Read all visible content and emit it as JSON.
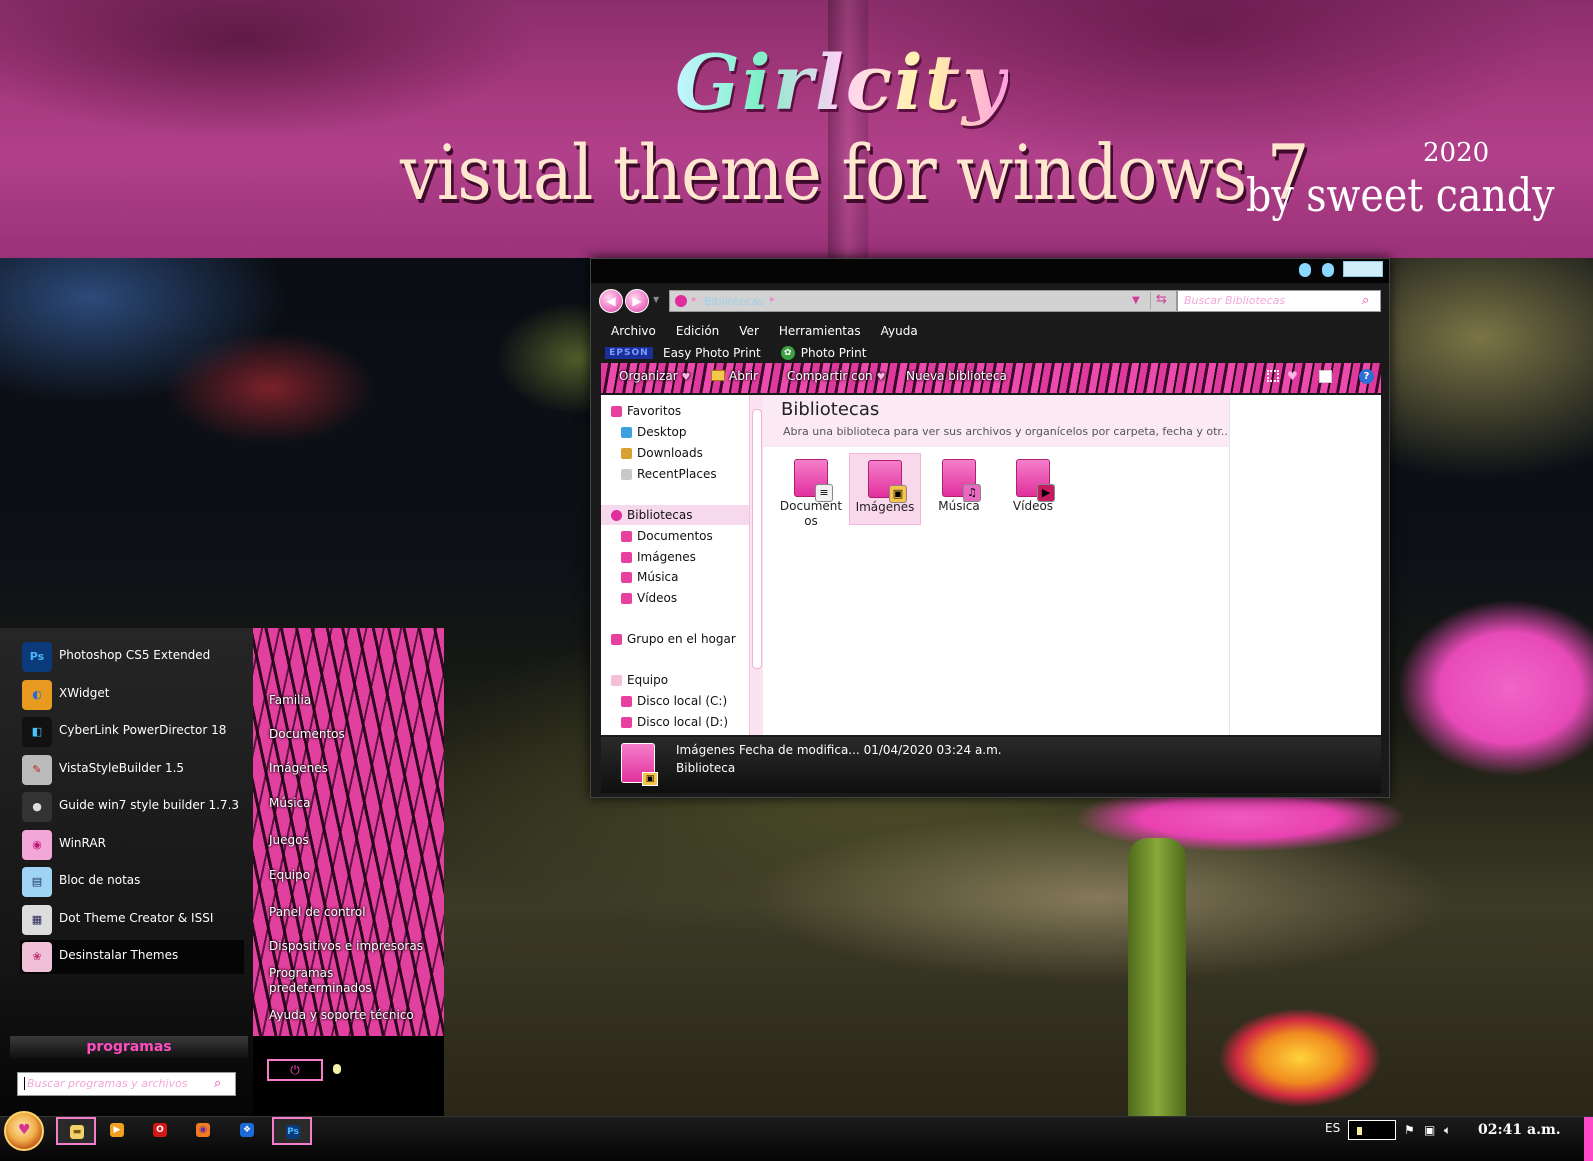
{
  "banner": {
    "theme_name": "Girlcity",
    "tagline": "visual theme  for windows 7",
    "year": "2020",
    "byline": "by sweet candy"
  },
  "explorer": {
    "address_crumb": "Bibliotecas",
    "search_placeholder": "Buscar Bibliotecas",
    "menu": [
      "Archivo",
      "Edición",
      "Ver",
      "Herramientas",
      "Ayuda"
    ],
    "ext_toolbar": {
      "epson_label": "EPSON",
      "easy_photo_print": "Easy Photo Print",
      "photo_print": "Photo Print"
    },
    "command_bar": {
      "organize": "Organizar",
      "open": "Abrir",
      "share": "Compartir con",
      "new_library": "Nueva biblioteca"
    },
    "nav_tree": [
      {
        "label": "Favoritos",
        "level": 0,
        "icon": "star-icon",
        "color": "#e8409e"
      },
      {
        "label": "Desktop",
        "level": 1,
        "icon": "desktop-icon",
        "color": "#3aa0e0"
      },
      {
        "label": "Downloads",
        "level": 1,
        "icon": "downloads-icon",
        "color": "#d8a030"
      },
      {
        "label": "RecentPlaces",
        "level": 1,
        "icon": "recent-places-icon",
        "color": "#c8c8c8"
      },
      {
        "label": "Bibliotecas",
        "level": 0,
        "icon": "library-icon",
        "color": "#e02c9c",
        "selected": true
      },
      {
        "label": "Documentos",
        "level": 1,
        "icon": "documents-icon",
        "color": "#e8409e"
      },
      {
        "label": "Imágenes",
        "level": 1,
        "icon": "images-icon",
        "color": "#e8409e"
      },
      {
        "label": "Música",
        "level": 1,
        "icon": "music-icon",
        "color": "#e8409e"
      },
      {
        "label": "Vídeos",
        "level": 1,
        "icon": "videos-icon",
        "color": "#e8409e"
      },
      {
        "label": "Grupo en el hogar",
        "level": 0,
        "icon": "homegroup-icon",
        "color": "#e8409e"
      },
      {
        "label": "Equipo",
        "level": 0,
        "icon": "computer-icon",
        "color": "#f3c0d8"
      },
      {
        "label": "Disco local (C:)",
        "level": 1,
        "icon": "drive-icon",
        "color": "#e8409e"
      },
      {
        "label": "Disco local (D:)",
        "level": 1,
        "icon": "drive-icon",
        "color": "#e8409e"
      }
    ],
    "content_title": "Bibliotecas",
    "content_desc": "Abra una biblioteca para ver sus archivos y organícelos por carpeta, fecha y otr...",
    "libraries": [
      {
        "label": "Document\nos",
        "badge": "≡",
        "badge_color": "#f0f0f0",
        "icon": "documents-library-icon"
      },
      {
        "label": "Imágenes",
        "badge": "▣",
        "badge_color": "#f5c54a",
        "icon": "images-library-icon",
        "selected": true
      },
      {
        "label": "Música",
        "badge": "♫",
        "badge_color": "#e86ac0",
        "icon": "music-library-icon"
      },
      {
        "label": "Vídeos",
        "badge": "▶",
        "badge_color": "#c81a60",
        "icon": "videos-library-icon"
      }
    ],
    "status": {
      "name": "Imágenes",
      "date": "Fecha de modifica... 01/04/2020 03:24 a.m.",
      "type": "Biblioteca"
    }
  },
  "start_menu": {
    "programs": [
      {
        "label": "Photoshop CS5 Extended",
        "icon": "photoshop-icon",
        "glyph": "Ps",
        "bg": "#0a3a7a",
        "fg": "#4ab4ff"
      },
      {
        "label": "XWidget",
        "icon": "xwidget-icon",
        "glyph": "◐",
        "bg": "#e89a20",
        "fg": "#2a6ad8"
      },
      {
        "label": "CyberLink PowerDirector 18",
        "icon": "powerdirector-icon",
        "glyph": "◧",
        "bg": "#111",
        "fg": "#4ac4ff"
      },
      {
        "label": "VistaStyleBuilder 1.5",
        "icon": "vistastylebuilder-icon",
        "glyph": "✎",
        "bg": "#bbb",
        "fg": "#c02020"
      },
      {
        "label": "Guide win7 style builder 1.7.3",
        "icon": "guide-icon",
        "glyph": "●",
        "bg": "#333",
        "fg": "#ddd"
      },
      {
        "label": "WinRAR",
        "icon": "winrar-icon",
        "glyph": "◉",
        "bg": "#f3a6d8",
        "fg": "#c01a7a"
      },
      {
        "label": "Bloc de notas",
        "icon": "notepad-icon",
        "glyph": "▤",
        "bg": "#9fd4f5",
        "fg": "#236"
      },
      {
        "label": "Dot Theme Creator & ISSI",
        "icon": "dot-theme-creator-icon",
        "glyph": "▦",
        "bg": "#ddd",
        "fg": "#225"
      },
      {
        "label": "Desinstalar Themes",
        "icon": "uninstall-themes-icon",
        "glyph": "❀",
        "bg": "#f0c0d8",
        "fg": "#c03070",
        "selected": true
      }
    ],
    "places": [
      "Familia",
      "Documentos",
      "Imágenes",
      "Música",
      "Juegos",
      "Equipo",
      "Panel de control",
      "Dispositivos e impresoras",
      "Programas\npredeterminados",
      "Ayuda y soporte técnico"
    ],
    "programs_label": "programas",
    "search_placeholder": "Buscar programas y archivos",
    "power_glyph": "⏻"
  },
  "taskbar": {
    "buttons": [
      {
        "icon": "explorer-icon",
        "glyph": "▬",
        "bg": "#f3d068",
        "fg": "#7a5a10",
        "active": true
      },
      {
        "icon": "media-player-icon",
        "glyph": "▶",
        "bg": "#f0a020",
        "fg": "#fff"
      },
      {
        "icon": "opera-icon",
        "glyph": "O",
        "bg": "#d01818",
        "fg": "#fff"
      },
      {
        "icon": "firefox-icon",
        "glyph": "◉",
        "bg": "#f07a20",
        "fg": "#6a2aa8"
      },
      {
        "icon": "dropbox-icon",
        "glyph": "❖",
        "bg": "#1a6ad8",
        "fg": "#fff"
      },
      {
        "icon": "photoshop-taskbar-icon",
        "glyph": "Ps",
        "bg": "#0a3a7a",
        "fg": "#4ab4ff",
        "active": true
      }
    ],
    "language": "ES",
    "clock": "02:41 a.m."
  },
  "colors": {
    "accent": "#e8409e",
    "accent_light": "#f57ecb"
  }
}
